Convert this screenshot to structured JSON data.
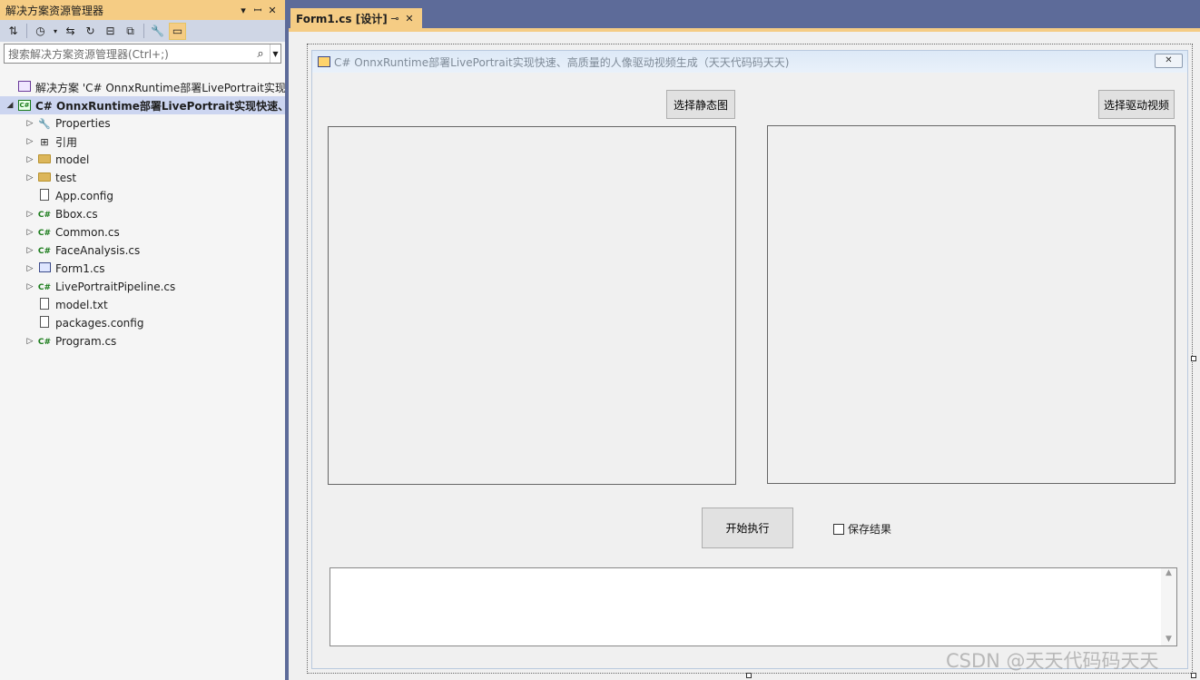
{
  "solution_explorer": {
    "title": "解决方案资源管理器",
    "pin_glyph": "▾",
    "dock_glyph": "ꟷ",
    "close_glyph": "✕",
    "search_placeholder": "搜索解决方案资源管理器(Ctrl+;)",
    "tree": {
      "solution": "解决方案 'C# OnnxRuntime部署LivePortrait实现快",
      "project": "C# OnnxRuntime部署LivePortrait实现快速、",
      "items": [
        {
          "label": "Properties",
          "icon": "wrench-icon",
          "expandable": true
        },
        {
          "label": "引用",
          "icon": "references-icon",
          "expandable": true
        },
        {
          "label": "model",
          "icon": "folder-icon",
          "expandable": true
        },
        {
          "label": "test",
          "icon": "folder-icon",
          "expandable": true
        },
        {
          "label": "App.config",
          "icon": "config-file-icon",
          "expandable": false
        },
        {
          "label": "Bbox.cs",
          "icon": "csharp-file-icon",
          "expandable": true
        },
        {
          "label": "Common.cs",
          "icon": "csharp-file-icon",
          "expandable": true
        },
        {
          "label": "FaceAnalysis.cs",
          "icon": "csharp-file-icon",
          "expandable": true
        },
        {
          "label": "Form1.cs",
          "icon": "form-file-icon",
          "expandable": true
        },
        {
          "label": "LivePortraitPipeline.cs",
          "icon": "csharp-file-icon",
          "expandable": true
        },
        {
          "label": "model.txt",
          "icon": "text-file-icon",
          "expandable": false
        },
        {
          "label": "packages.config",
          "icon": "config-file-icon",
          "expandable": false
        },
        {
          "label": "Program.cs",
          "icon": "csharp-file-icon",
          "expandable": true
        }
      ]
    }
  },
  "document_tab": {
    "title": "Form1.cs [设计]",
    "pin_glyph": "⊸",
    "close_glyph": "✕"
  },
  "form": {
    "title": "C# OnnxRuntime部署LivePortrait实现快速、高质量的人像驱动视频生成（天天代码码天天)",
    "close_glyph": "✕",
    "select_image_button": "选择静态图",
    "select_video_button": "选择驱动视频",
    "run_button": "开始执行",
    "save_checkbox_label": "保存结果"
  },
  "watermark": "CSDN @天天代码码天天",
  "colors": {
    "accent": "#f5cc84",
    "frame": "#5d6b99",
    "selection": "#ccd5f0",
    "csharp": "#1a7b1a"
  }
}
